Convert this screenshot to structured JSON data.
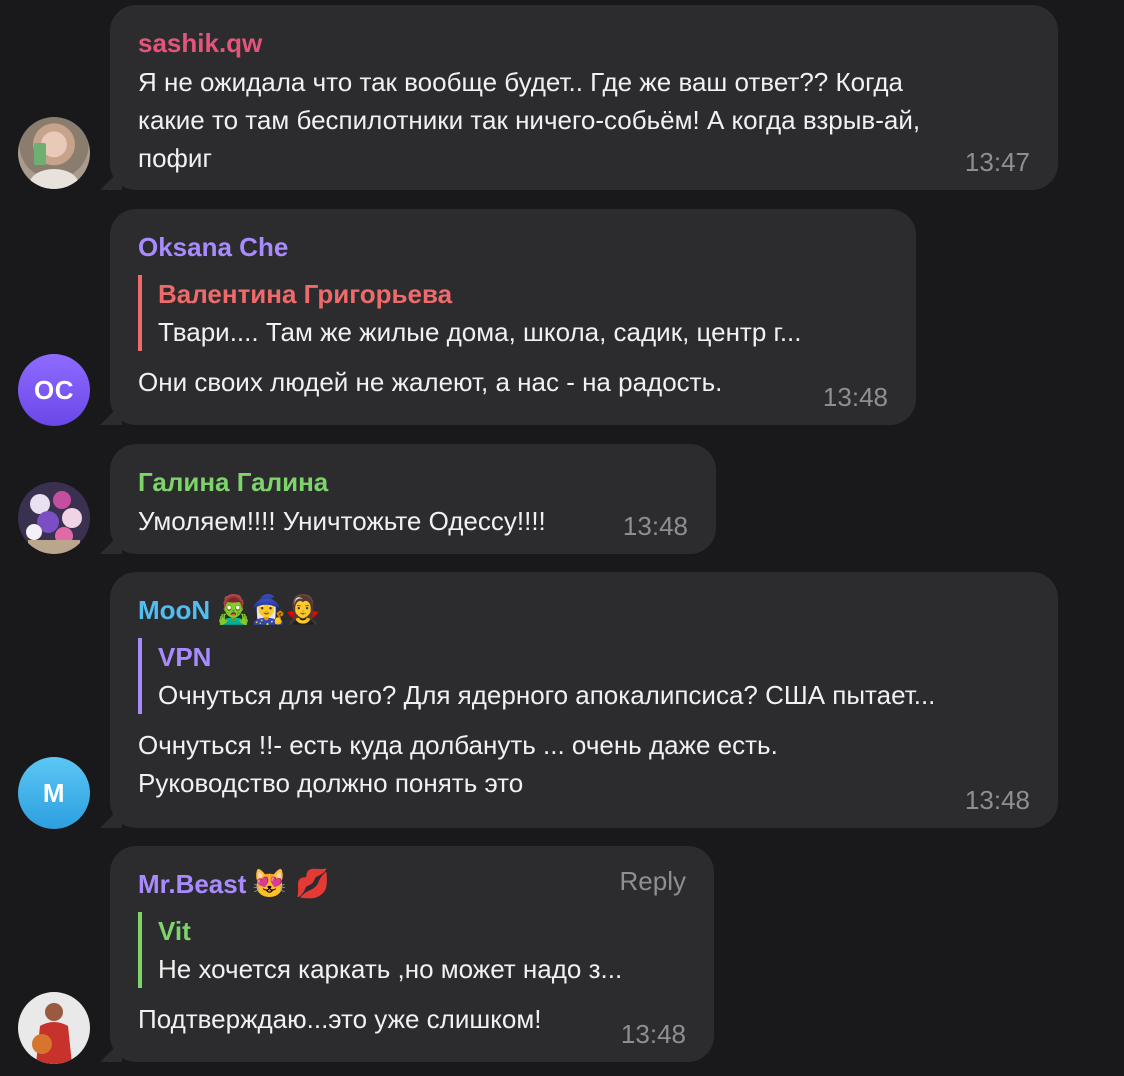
{
  "messages": [
    {
      "id": "sashik",
      "sender": "sashik.qw",
      "sender_color": "#e5547b",
      "lines": [
        "Я не ожидала что так вообще будет.. Где же ваш ответ?? Когда",
        "какие то там беспилотники так ничего-собьём! А когда взрыв-ай,",
        "пофиг"
      ],
      "time": "13:47",
      "avatar_type": "photo"
    },
    {
      "id": "oksana",
      "sender": "Oksana Che",
      "sender_color": "#a98bff",
      "avatar_initials": "OC",
      "quote": {
        "name": "Валентина Григорьева",
        "text": "Твари.... Там же жилые дома, школа, садик, центр г...",
        "color": "#ef6a6a"
      },
      "text": "Они своих людей не жалеют, а нас - на радость.",
      "time": "13:48"
    },
    {
      "id": "galina",
      "sender": "Галина Галина",
      "sender_color": "#7ed36a",
      "text": "Умоляем!!!! Уничтожьте Одессу!!!!",
      "time": "13:48",
      "avatar_type": "photo"
    },
    {
      "id": "moon",
      "sender": "MooN",
      "sender_color": "#52bdf0",
      "sender_emoji": "🧟‍♂️🧙‍♀️🧛‍♀️",
      "avatar_initials": "M",
      "quote": {
        "name": "VPN",
        "text": "Очнуться для чего? Для ядерного апокалипсиса? США пытает...",
        "color": "#a98bff"
      },
      "lines": [
        "Очнуться !!- есть куда долбануть ... очень даже есть.",
        "Руководство должно понять это"
      ],
      "time": "13:48"
    },
    {
      "id": "mrbeast",
      "sender": "Mr.Beast",
      "sender_color": "#a98bff",
      "sender_emoji": "😻 💋",
      "reply_label": "Reply",
      "quote": {
        "name": "Vit",
        "text": "Не хочется каркать ,но может надо з...",
        "color": "#7ed36a"
      },
      "text": "Подтверждаю...это уже слишком!",
      "time": "13:48",
      "avatar_type": "photo"
    }
  ]
}
